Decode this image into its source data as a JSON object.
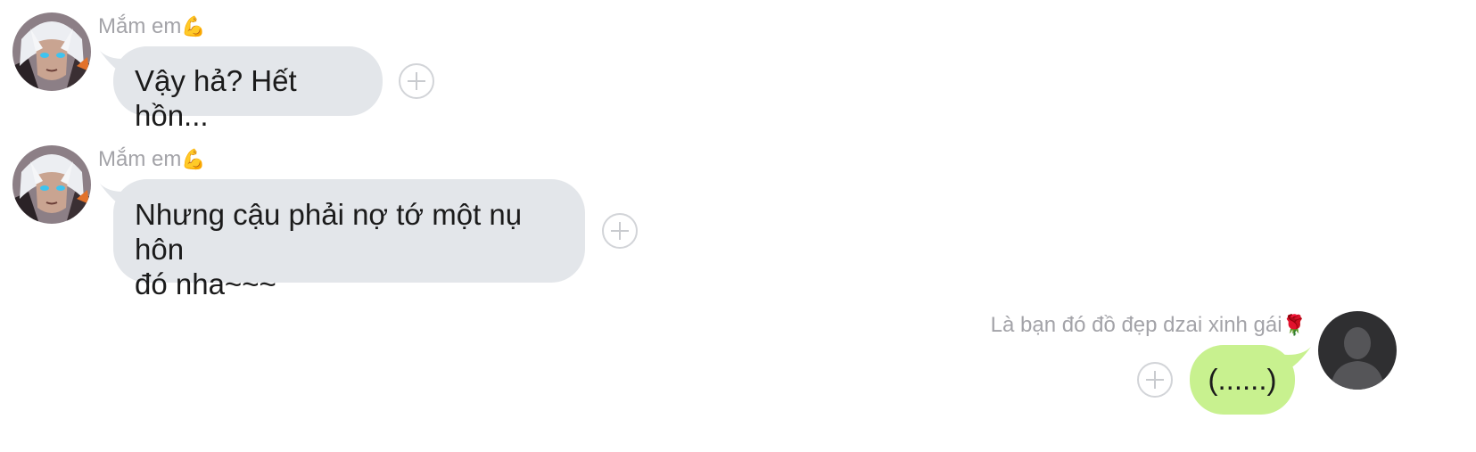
{
  "messages": [
    {
      "direction": "incoming",
      "sender": "Mắm em",
      "sender_emoji": "💪",
      "text": "Vậy hả? Hết hồn..."
    },
    {
      "direction": "incoming",
      "sender": "Mắm em",
      "sender_emoji": "💪",
      "text_lines": [
        "Nhưng cậu phải nợ tớ một nụ hôn",
        "đó nha~~~"
      ]
    },
    {
      "direction": "outgoing",
      "sender": "Là bạn đó đồ đẹp dzai xinh gái",
      "sender_emoji": "🌹",
      "text": "(......)"
    }
  ],
  "colors": {
    "incoming_bubble": "#e3e6ea",
    "outgoing_bubble": "#c8f18f",
    "sender_name": "#a3a3a8",
    "message_text": "#1b1b1b"
  },
  "icons": {
    "reaction_button": "plus-circle-icon",
    "incoming_avatar": "anime-avatar",
    "outgoing_avatar": "default-user-silhouette"
  }
}
